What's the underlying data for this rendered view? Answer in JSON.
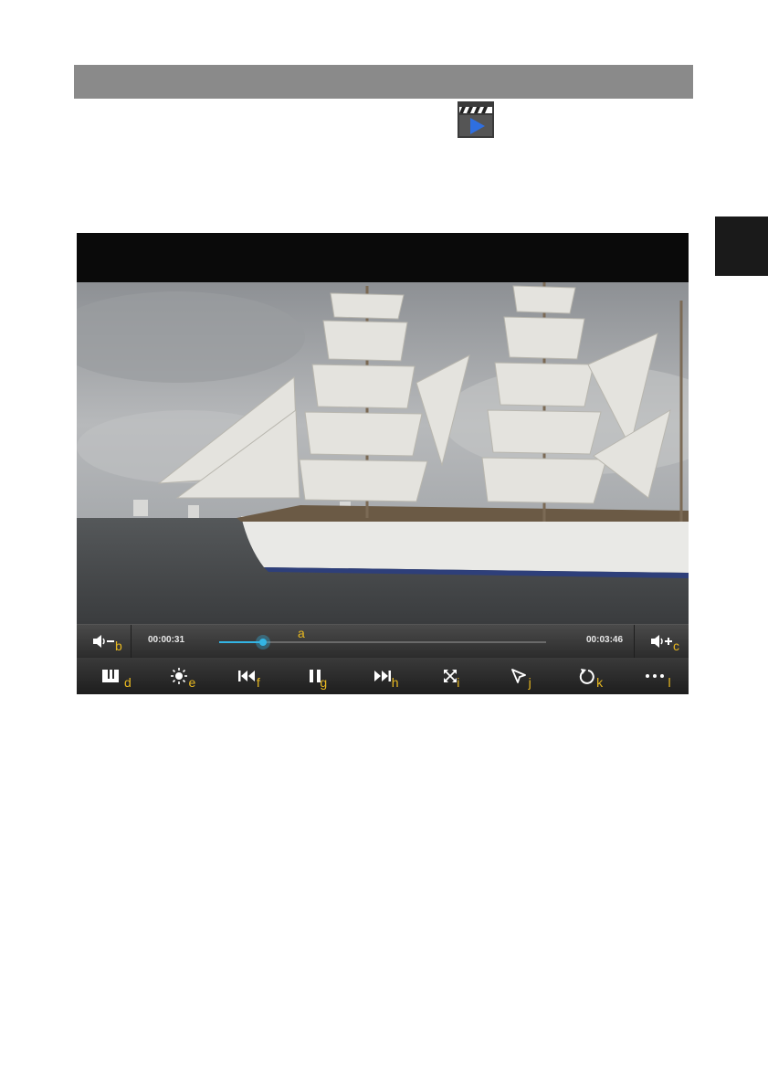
{
  "app_icon": "video-player-clapperboard-icon",
  "player": {
    "progress": {
      "current_time": "00:00:31",
      "total_time": "00:03:46",
      "position_fraction": 0.135
    },
    "callouts": {
      "a": "a",
      "b": "b",
      "c": "c",
      "d": "d",
      "e": "e",
      "f": "f",
      "g": "g",
      "h": "h",
      "i": "i",
      "j": "j",
      "k": "k",
      "l": "l"
    },
    "controls": [
      {
        "icon": "bookmark-icon",
        "callout": "d"
      },
      {
        "icon": "brightness-icon",
        "callout": "e"
      },
      {
        "icon": "previous-track-icon",
        "callout": "f"
      },
      {
        "icon": "pause-icon",
        "callout": "g"
      },
      {
        "icon": "next-track-icon",
        "callout": "h"
      },
      {
        "icon": "fullscreen-icon",
        "callout": "i"
      },
      {
        "icon": "cursor-icon",
        "callout": "j"
      },
      {
        "icon": "repeat-icon",
        "callout": "k"
      },
      {
        "icon": "more-options-icon",
        "callout": "l"
      }
    ],
    "colors": {
      "accent": "#33b5e5",
      "callout": "#e8b820"
    }
  }
}
